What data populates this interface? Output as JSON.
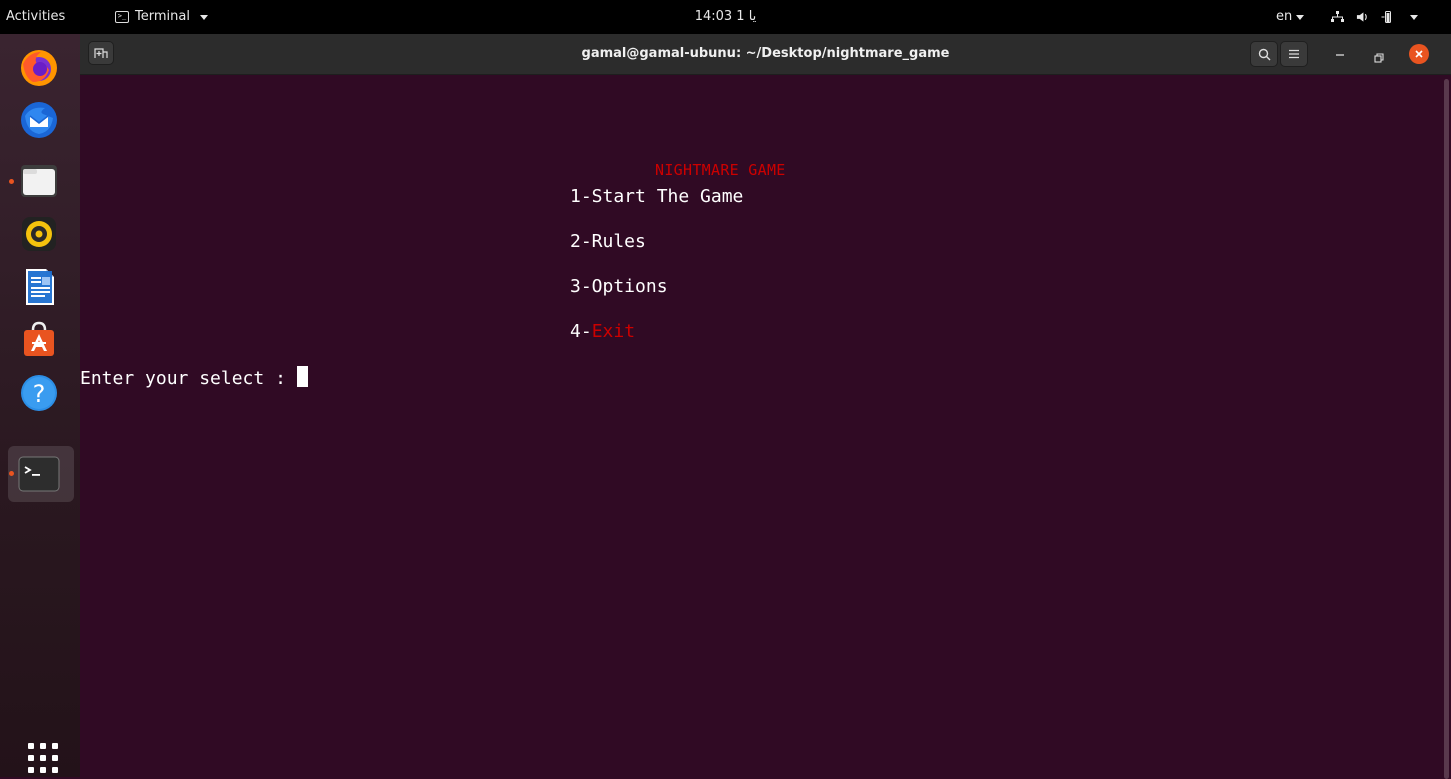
{
  "topbar": {
    "activities": "Activities",
    "app_name": "Terminal",
    "clock": "14:03 1 يا",
    "language": "en"
  },
  "dock": {
    "apps": [
      {
        "name": "firefox-icon"
      },
      {
        "name": "thunderbird-icon"
      },
      {
        "name": "files-icon"
      },
      {
        "name": "rhythmbox-icon"
      },
      {
        "name": "libreoffice-writer-icon"
      },
      {
        "name": "software-icon"
      },
      {
        "name": "help-icon"
      },
      {
        "name": "terminal-icon"
      }
    ]
  },
  "window": {
    "title": "gamal@gamal-ubunu: ~/Desktop/nightmare_game"
  },
  "terminal": {
    "game_title": "NIGHTMARE GAME",
    "option1": "1-Start The Game",
    "option2": "2-Rules",
    "option3": "3-Options",
    "option4_prefix": "4-",
    "option4_label": "Exit",
    "prompt": "Enter your select : "
  },
  "colors": {
    "terminal_bg": "#300a24",
    "accent": "#e95420",
    "red_text": "#cc0000"
  }
}
